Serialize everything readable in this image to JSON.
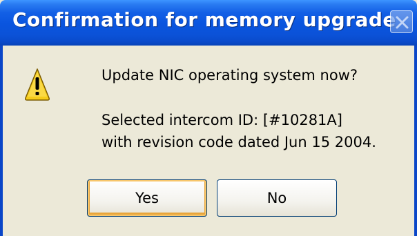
{
  "dialog": {
    "title": "Confirmation for memory upgrade",
    "question": "Update NIC operating system now?",
    "detail_line1": "Selected intercom ID:  [#10281A]",
    "detail_line2": "with revision code dated Jun 15 2004.",
    "icon": "warning-icon"
  },
  "buttons": {
    "yes_label": "Yes",
    "no_label": "No"
  },
  "colors": {
    "titlebar": "#0a55df",
    "background": "#ece9d8",
    "warning": "#f6cc1a"
  }
}
